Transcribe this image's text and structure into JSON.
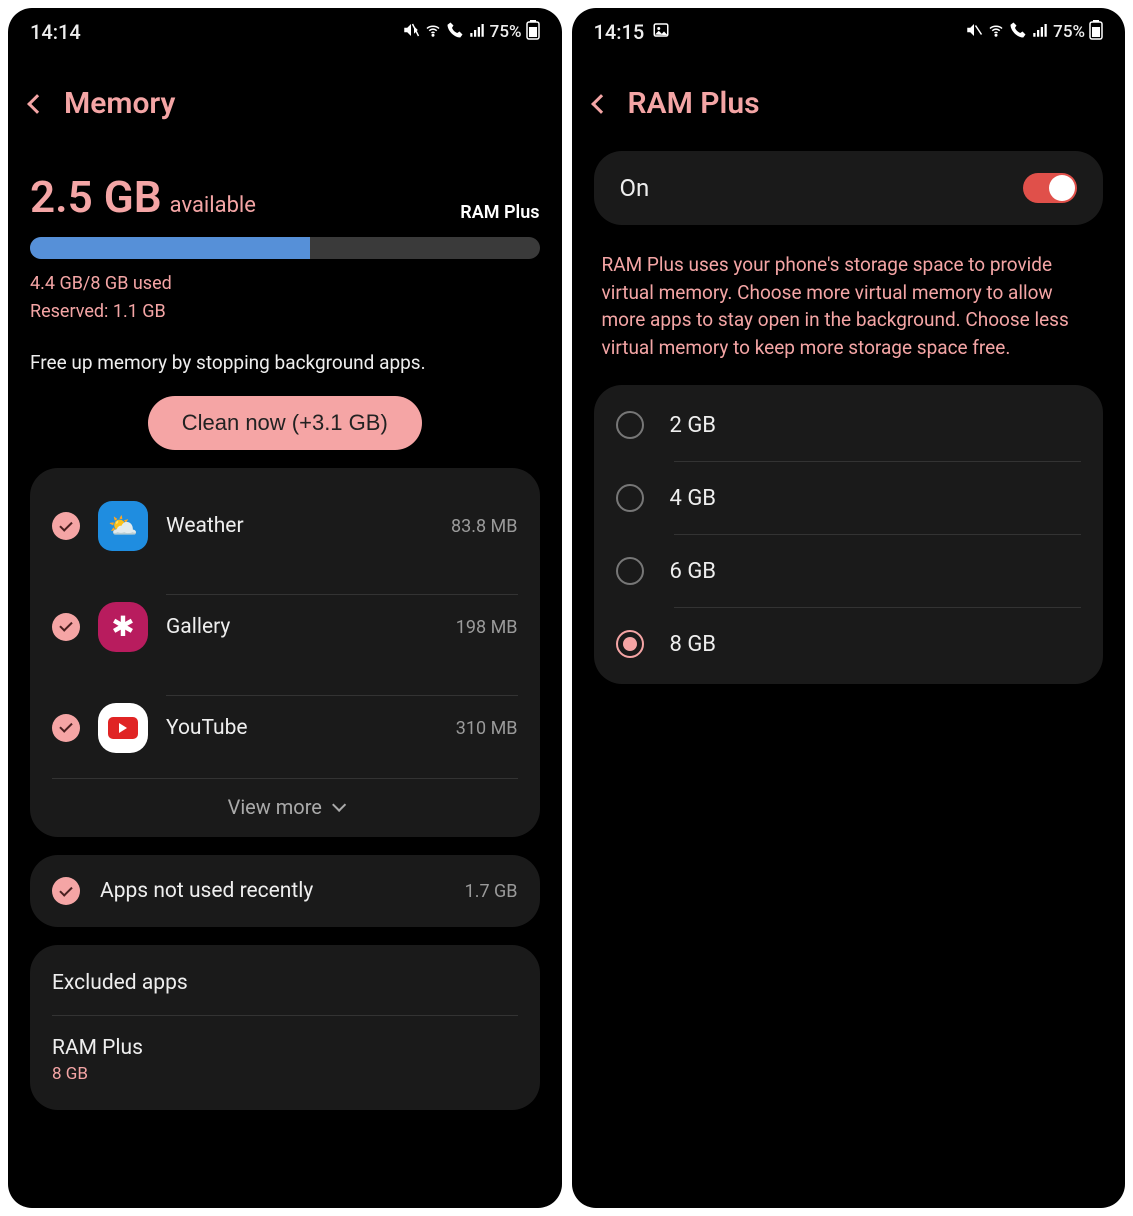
{
  "left": {
    "status": {
      "time": "14:14",
      "battery": "75%"
    },
    "title": "Memory",
    "available_value": "2.5 GB",
    "available_label": "available",
    "ram_plus_link": "RAM Plus",
    "progress_pct": 55,
    "used_line": "4.4 GB/8 GB used",
    "reserved_line": "Reserved: 1.1 GB",
    "hint": "Free up memory by stopping background apps.",
    "clean_button": "Clean now (+3.1 GB)",
    "apps": [
      {
        "name": "Weather",
        "size": "83.8 MB",
        "icon": "weather"
      },
      {
        "name": "Gallery",
        "size": "198 MB",
        "icon": "gallery"
      },
      {
        "name": "YouTube",
        "size": "310 MB",
        "icon": "youtube"
      }
    ],
    "view_more": "View more",
    "not_used": {
      "label": "Apps not used recently",
      "size": "1.7 GB"
    },
    "settings": {
      "excluded": "Excluded apps",
      "ram_plus_label": "RAM Plus",
      "ram_plus_value": "8 GB"
    }
  },
  "right": {
    "status": {
      "time": "14:15",
      "battery": "75%"
    },
    "title": "RAM Plus",
    "toggle_label": "On",
    "toggle_on": true,
    "description": "RAM Plus uses your phone's storage space to provide virtual memory. Choose more virtual memory to allow more apps to stay open in the background. Choose less virtual memory to keep more storage space free.",
    "options": [
      {
        "label": "2 GB",
        "selected": false
      },
      {
        "label": "4 GB",
        "selected": false
      },
      {
        "label": "6 GB",
        "selected": false
      },
      {
        "label": "8 GB",
        "selected": true
      }
    ]
  }
}
